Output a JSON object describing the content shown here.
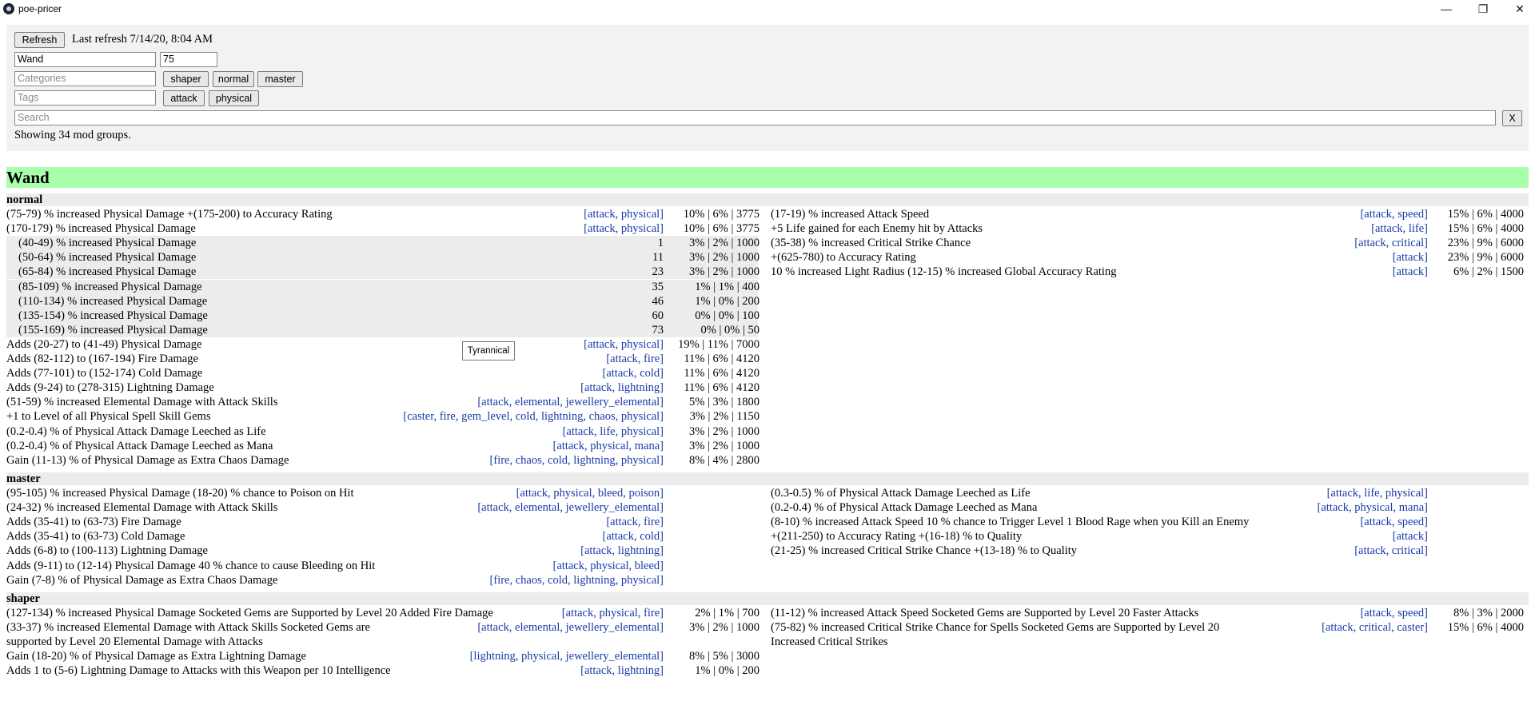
{
  "window": {
    "title": "poe-pricer",
    "minimize": "—",
    "maximize": "❐",
    "close": "✕"
  },
  "controls": {
    "refresh_label": "Refresh",
    "last_refresh": "Last refresh 7/14/20, 8:04 AM",
    "item_value": "Wand",
    "level_value": "75",
    "categories_placeholder": "Categories",
    "category_chips": [
      "shaper",
      "normal",
      "master"
    ],
    "tags_placeholder": "Tags",
    "tag_chips": [
      "attack",
      "physical"
    ],
    "search_placeholder": "Search",
    "clear_label": "X",
    "summary": "Showing 34 mod groups."
  },
  "item": {
    "name": "Wand"
  },
  "tooltip": "Tyrannical",
  "sections": [
    {
      "name": "normal",
      "left": [
        {
          "text": "(75-79) % increased Physical Damage +(175-200) to Accuracy Rating",
          "tags": "[attack, physical]",
          "stats": "10% | 6% | 3775"
        },
        {
          "text": "(170-179) % increased Physical Damage",
          "tags": "[attack, physical]",
          "stats": "10% | 6% | 3775"
        },
        {
          "text": "(40-49) % increased Physical Damage",
          "tags": "1",
          "stats": "3% | 2% | 1000",
          "sub": true
        },
        {
          "text": "(50-64) % increased Physical Damage",
          "tags": "11",
          "stats": "3% | 2% | 1000",
          "sub": true
        },
        {
          "text": "(65-84) % increased Physical Damage",
          "tags": "23",
          "stats": "3% | 2% | 1000",
          "sub": true
        },
        {
          "text": "(85-109) % increased Physical Damage",
          "tags": "35",
          "stats": "1% | 1% | 400",
          "sub": true
        },
        {
          "text": "(110-134) % increased Physical Damage",
          "tags": "46",
          "stats": "1% | 0% | 200",
          "sub": true
        },
        {
          "text": "(135-154) % increased Physical Damage",
          "tags": "60",
          "stats": "0% | 0% | 100",
          "sub": true
        },
        {
          "text": "(155-169) % increased Physical Damage",
          "tags": "73",
          "stats": "0% | 0% | 50",
          "sub": true
        },
        {
          "text": "Adds (20-27) to (41-49) Physical Damage",
          "tags": "[attack, physical]",
          "stats": "19% | 11% | 7000"
        },
        {
          "text": "Adds (82-112) to (167-194) Fire Damage",
          "tags": "[attack, fire]",
          "stats": "11% | 6% | 4120"
        },
        {
          "text": "Adds (77-101) to (152-174) Cold Damage",
          "tags": "[attack, cold]",
          "stats": "11% | 6% | 4120"
        },
        {
          "text": "Adds (9-24) to (278-315) Lightning Damage",
          "tags": "[attack, lightning]",
          "stats": "11% | 6% | 4120"
        },
        {
          "text": "(51-59) % increased Elemental Damage with Attack Skills",
          "tags": "[attack, elemental, jewellery_elemental]",
          "stats": "5% | 3% | 1800"
        },
        {
          "text": "+1 to Level of all Physical Spell Skill Gems",
          "tags": "[caster, fire, gem_level, cold, lightning, chaos, physical]",
          "stats": "3% | 2% | 1150"
        },
        {
          "text": "(0.2-0.4) % of Physical Attack Damage Leeched as Life",
          "tags": "[attack, life, physical]",
          "stats": "3% | 2% | 1000"
        },
        {
          "text": "(0.2-0.4) % of Physical Attack Damage Leeched as Mana",
          "tags": "[attack, physical, mana]",
          "stats": "3% | 2% | 1000"
        },
        {
          "text": "Gain (11-13) % of Physical Damage as Extra Chaos Damage",
          "tags": "[fire, chaos, cold, lightning, physical]",
          "stats": "8% | 4% | 2800"
        }
      ],
      "right": [
        {
          "text": "(17-19) % increased Attack Speed",
          "tags": "[attack, speed]",
          "stats": "15% | 6% | 4000"
        },
        {
          "text": "+5 Life gained for each Enemy hit by Attacks",
          "tags": "[attack, life]",
          "stats": "15% | 6% | 4000"
        },
        {
          "text": "(35-38) % increased Critical Strike Chance",
          "tags": "[attack, critical]",
          "stats": "23% | 9% | 6000"
        },
        {
          "text": "+(625-780) to Accuracy Rating",
          "tags": "[attack]",
          "stats": "23% | 9% | 6000"
        },
        {
          "text": "10 % increased Light Radius (12-15) % increased Global Accuracy Rating",
          "tags": "[attack]",
          "stats": "6% | 2% | 1500"
        }
      ]
    },
    {
      "name": "master",
      "left": [
        {
          "text": "(95-105) % increased Physical Damage (18-20) % chance to Poison on Hit",
          "tags": "[attack, physical, bleed, poison]",
          "stats": ""
        },
        {
          "text": "(24-32) % increased Elemental Damage with Attack Skills",
          "tags": "[attack, elemental, jewellery_elemental]",
          "stats": ""
        },
        {
          "text": "Adds (35-41) to (63-73) Fire Damage",
          "tags": "[attack, fire]",
          "stats": ""
        },
        {
          "text": "Adds (35-41) to (63-73) Cold Damage",
          "tags": "[attack, cold]",
          "stats": ""
        },
        {
          "text": "Adds (6-8) to (100-113) Lightning Damage",
          "tags": "[attack, lightning]",
          "stats": ""
        },
        {
          "text": "Adds (9-11) to (12-14) Physical Damage 40 % chance to cause Bleeding on Hit",
          "tags": "[attack, physical, bleed]",
          "stats": ""
        },
        {
          "text": "Gain (7-8) % of Physical Damage as Extra Chaos Damage",
          "tags": "[fire, chaos, cold, lightning, physical]",
          "stats": ""
        }
      ],
      "right": [
        {
          "text": "(0.3-0.5) % of Physical Attack Damage Leeched as Life",
          "tags": "[attack, life, physical]",
          "stats": ""
        },
        {
          "text": "(0.2-0.4) % of Physical Attack Damage Leeched as Mana",
          "tags": "[attack, physical, mana]",
          "stats": ""
        },
        {
          "text": "(8-10) % increased Attack Speed 10 % chance to Trigger Level 1 Blood Rage when you Kill an Enemy",
          "tags": "[attack, speed]",
          "stats": ""
        },
        {
          "text": "+(211-250) to Accuracy Rating +(16-18) % to Quality",
          "tags": "[attack]",
          "stats": ""
        },
        {
          "text": "(21-25) % increased Critical Strike Chance +(13-18) % to Quality",
          "tags": "[attack, critical]",
          "stats": ""
        }
      ]
    },
    {
      "name": "shaper",
      "left": [
        {
          "text": "(127-134) % increased Physical Damage Socketed Gems are Supported by Level 20 Added Fire Damage",
          "tags": "[attack, physical, fire]",
          "stats": "2% | 1% | 700"
        },
        {
          "text": "(33-37) % increased Elemental Damage with Attack Skills Socketed Gems are",
          "text2": "supported by Level 20 Elemental Damage with Attacks",
          "tags": "[attack, elemental, jewellery_elemental]",
          "stats": "3% | 2% | 1000"
        },
        {
          "text": "Gain (18-20) % of Physical Damage as Extra Lightning Damage",
          "tags": "[lightning, physical, jewellery_elemental]",
          "stats": "8% | 5% | 3000"
        },
        {
          "text": "Adds 1 to (5-6) Lightning Damage to Attacks with this Weapon per 10 Intelligence",
          "tags": "[attack, lightning]",
          "stats": "1% | 0% | 200"
        }
      ],
      "right": [
        {
          "text": "(11-12) % increased Attack Speed Socketed Gems are Supported by Level 20 Faster Attacks",
          "tags": "[attack, speed]",
          "stats": "8% | 3% | 2000"
        },
        {
          "text": "(75-82) % increased Critical Strike Chance for Spells Socketed Gems are Supported by Level 20",
          "text2": "Increased Critical Strikes",
          "tags": "[attack, critical, caster]",
          "stats": "15% | 6% | 4000"
        }
      ]
    }
  ]
}
